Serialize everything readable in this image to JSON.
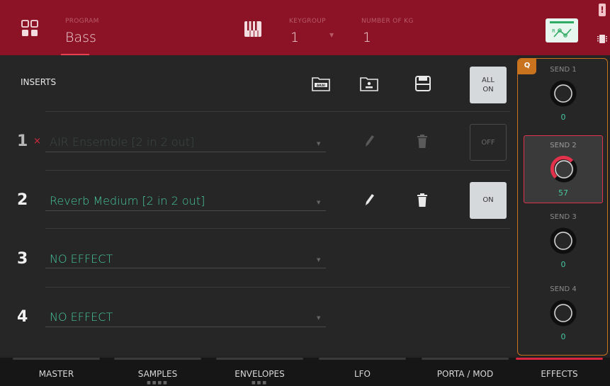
{
  "header": {
    "program_label": "PROGRAM",
    "program_value": "Bass",
    "keygroup_label": "KEYGROUP",
    "keygroup_value": "1",
    "num_kg_label": "NUMBER OF KG",
    "num_kg_value": "1",
    "warning_mark": "!"
  },
  "inserts": {
    "title": "INSERTS",
    "all_on_label_1": "ALL",
    "all_on_label_2": "ON",
    "akai_icon_text": "AKAI",
    "rows": [
      {
        "number": "1",
        "bypassed_mark": "×",
        "effect": "AIR Ensemble [2 in 2 out]",
        "state": "OFF"
      },
      {
        "number": "2",
        "effect": "Reverb Medium [2 in 2 out]",
        "state": "ON"
      },
      {
        "number": "3",
        "effect": "NO EFFECT"
      },
      {
        "number": "4",
        "effect": "NO EFFECT"
      }
    ]
  },
  "sends": {
    "q_badge": "Q",
    "items": [
      {
        "label": "SEND 1",
        "value": "0"
      },
      {
        "label": "SEND 2",
        "value": "57"
      },
      {
        "label": "SEND 3",
        "value": "0"
      },
      {
        "label": "SEND 4",
        "value": "0"
      }
    ],
    "accent_color": "#c9731f",
    "active_color": "#e2314a"
  },
  "footer": {
    "tabs": [
      {
        "label": "MASTER"
      },
      {
        "label": "SAMPLES"
      },
      {
        "label": "ENVELOPES"
      },
      {
        "label": "LFO"
      },
      {
        "label": "PORTA / MOD"
      },
      {
        "label": "EFFECTS"
      }
    ],
    "active_tab": "EFFECTS"
  },
  "colors": {
    "header_bg": "#8b1325",
    "effect_text": "#47c79f",
    "active_red": "#d7263d"
  }
}
